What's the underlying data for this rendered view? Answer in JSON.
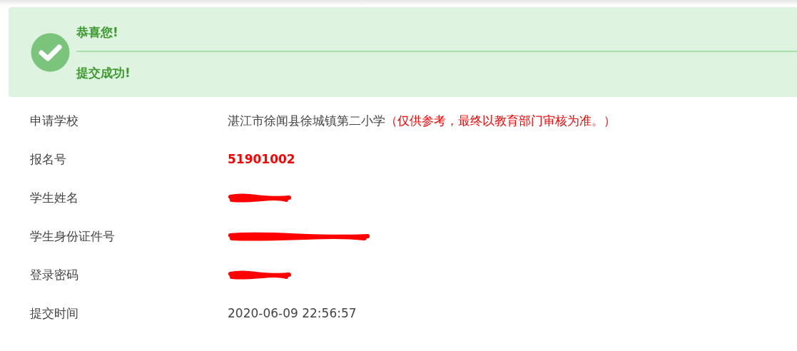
{
  "alert": {
    "title": "恭喜您!",
    "message": "提交成功!"
  },
  "rows": [
    {
      "label": "申请学校",
      "kind": "school",
      "value": "湛江市徐闻县徐城镇第二小学",
      "note": "（仅供参考，最终以教育部门审核为准。）"
    },
    {
      "label": "报名号",
      "kind": "highlight",
      "value": "51901002"
    },
    {
      "label": "学生姓名",
      "kind": "redacted"
    },
    {
      "label": "学生身份证件号",
      "kind": "redacted_long"
    },
    {
      "label": "登录密码",
      "kind": "redacted"
    },
    {
      "label": "提交时间",
      "kind": "plain",
      "value": "2020-06-09 22:56:57"
    }
  ]
}
